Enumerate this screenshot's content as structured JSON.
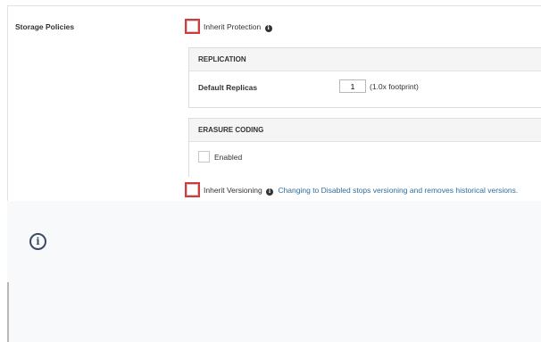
{
  "section": {
    "title": "Storage Policies"
  },
  "inherit_protection": {
    "label": "Inherit Protection",
    "info_glyph": "i"
  },
  "replication": {
    "header": "REPLICATION",
    "default_replicas_label": "Default Replicas",
    "default_replicas_value": "1",
    "footprint_hint": "(1.0x footprint)"
  },
  "erasure_coding": {
    "header": "ERASURE CODING",
    "enabled_label": "Enabled"
  },
  "inherit_versioning": {
    "label": "Inherit Versioning",
    "info_glyph": "i",
    "warning": "Changing to Disabled stops versioning and removes historical versions."
  },
  "notice": {
    "icon": "info-circle-icon",
    "glyph": "i"
  },
  "colors": {
    "highlight": "#d43a3a",
    "link_text": "#2f6e9d",
    "panel_header_bg": "#f5f5f5",
    "lower_area_bg": "#f8f9fa"
  }
}
